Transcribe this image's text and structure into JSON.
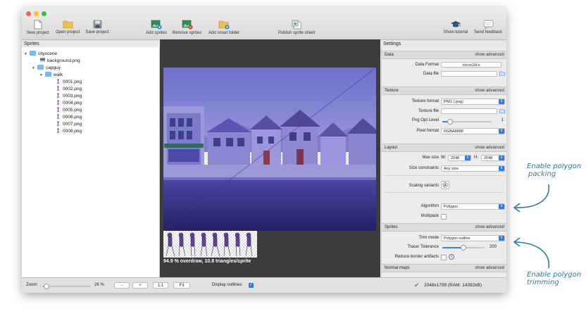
{
  "toolbar": {
    "new_project": "New project",
    "open_project": "Open project",
    "save_project": "Save project",
    "add_sprites": "Add sprites",
    "remove_sprites": "Remove sprites",
    "add_smart_folder": "Add smart folder",
    "publish_sprite_sheet": "Publish sprite sheet",
    "show_tutorial": "Show tutorial",
    "send_feedback": "Send feedback"
  },
  "sprites_panel": {
    "title": "Sprites",
    "tree": [
      {
        "label": "cityscene",
        "type": "folder"
      },
      {
        "label": "background.png",
        "type": "file"
      },
      {
        "label": "capguy",
        "type": "folder"
      },
      {
        "label": "walk",
        "type": "folder"
      },
      {
        "label": "0001.png",
        "type": "file"
      },
      {
        "label": "0002.png",
        "type": "file"
      },
      {
        "label": "0003.png",
        "type": "file"
      },
      {
        "label": "0004.png",
        "type": "file"
      },
      {
        "label": "0005.png",
        "type": "file"
      },
      {
        "label": "0006.png",
        "type": "file"
      },
      {
        "label": "0007.png",
        "type": "file"
      },
      {
        "label": "0008.png",
        "type": "file"
      }
    ]
  },
  "canvas": {
    "overlay_text": "94.9 % overdraw, 10.8 triangles/sprite"
  },
  "settings": {
    "title": "Settings",
    "sections": {
      "data": {
        "title": "Data",
        "advanced": "show advanced"
      },
      "texture": {
        "title": "Texture",
        "advanced": "show advanced"
      },
      "layout": {
        "title": "Layout",
        "advanced": "show advanced"
      },
      "sprites": {
        "title": "Sprites",
        "advanced": "show advanced"
      },
      "normal_maps": {
        "title": "Normal maps",
        "advanced": "show advanced"
      }
    },
    "data_format_label": "Data Format",
    "data_format_value": "cocos2d-x",
    "data_file_label": "Data file",
    "texture_format_label": "Texture format",
    "texture_format_value": "PNG (.png)",
    "texture_file_label": "Texture file",
    "png_opt_label": "Png Opt Level",
    "png_opt_value": "1",
    "png_opt_fraction": 0.15,
    "pixel_format_label": "Pixel format",
    "pixel_format_value": "RGBA8888",
    "max_size_label": "Max size",
    "w_label": "W:",
    "w_value": "2048",
    "h_label": "H:",
    "h_value": "2048",
    "size_constraints_label": "Size constraints",
    "size_constraints_value": "Any size",
    "scaling_variants_label": "Scaling variants",
    "algorithm_label": "Algorithm",
    "algorithm_value": "Polygon",
    "multipack_label": "Multipack",
    "trim_mode_label": "Trim mode",
    "trim_mode_value": "Polygon outline",
    "tracer_tolerance_label": "Tracer Tolerance",
    "tracer_tolerance_value": "200",
    "tracer_fraction": 0.5,
    "reduce_border_label": "Reduce border artifacts"
  },
  "statusbar": {
    "zoom_label": "Zoom:",
    "zoom_value": "26 %",
    "zoom_fraction": 0.08,
    "minus": "-",
    "plus": "+",
    "one_to_one": "1:1",
    "fit": "Fit",
    "display_outlines": "Display outlines:",
    "size_info": "2048x1799 (RAM: 14392kB)"
  },
  "annotations": {
    "polygon_packing_line1": "Enable polygon",
    "polygon_packing_line2": "packing",
    "polygon_trimming_line1": "Enable polygon",
    "polygon_trimming_line2": "trimming"
  },
  "colors": {
    "accent": "#2f7de1",
    "annotation": "#2f7a96",
    "sky": "#8486d6",
    "street": "#2d2a78"
  }
}
